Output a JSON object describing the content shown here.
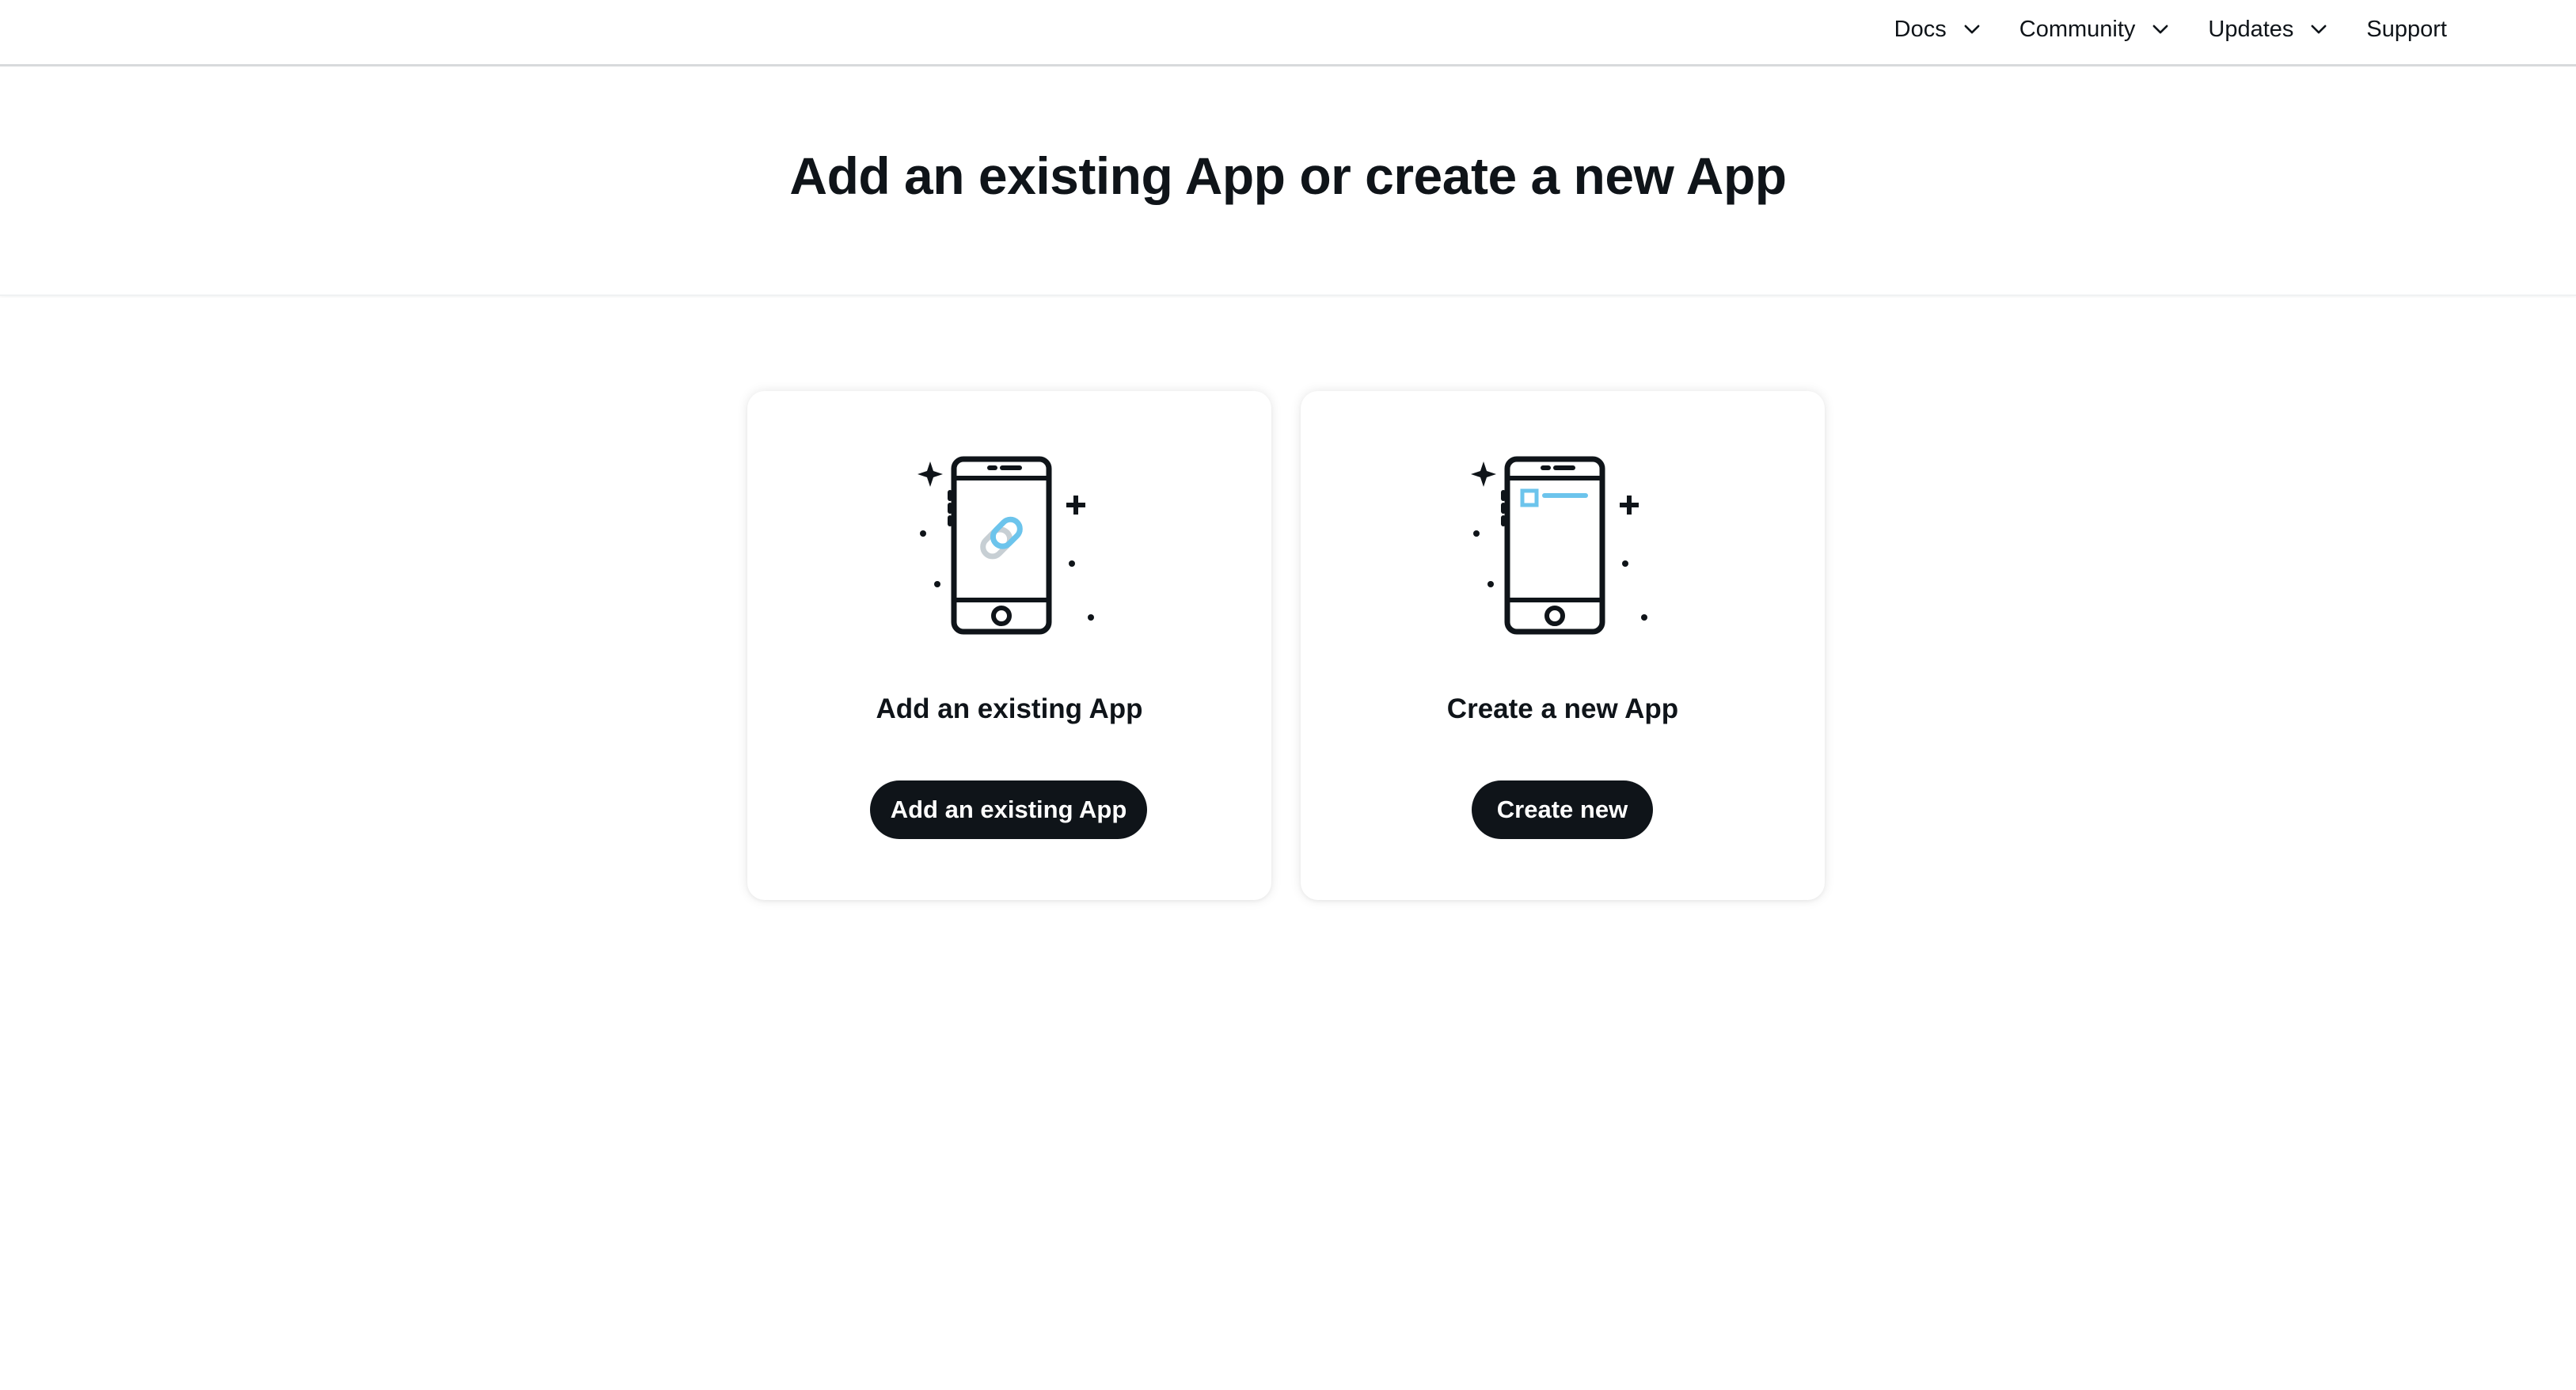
{
  "nav": {
    "items": [
      {
        "label": "Docs",
        "has_dropdown": true,
        "icon": "chevron-down-icon"
      },
      {
        "label": "Community",
        "has_dropdown": true,
        "icon": "chevron-down-icon"
      },
      {
        "label": "Updates",
        "has_dropdown": true,
        "icon": "chevron-down-icon"
      },
      {
        "label": "Support",
        "has_dropdown": false
      }
    ]
  },
  "hero": {
    "title": "Add an existing App or create a new App"
  },
  "cards": [
    {
      "title": "Add an existing App",
      "button_label": "Add an existing App",
      "icon": "phone-link-icon"
    },
    {
      "title": "Create a new App",
      "button_label": "Create new",
      "icon": "phone-new-app-icon"
    }
  ],
  "colors": {
    "text": "#0f1419",
    "button_bg": "#0f1419",
    "button_text": "#ffffff",
    "accent_blue": "#6cc4ec",
    "accent_gray": "#c7cfd4",
    "nav_border": "#d8dadc"
  }
}
